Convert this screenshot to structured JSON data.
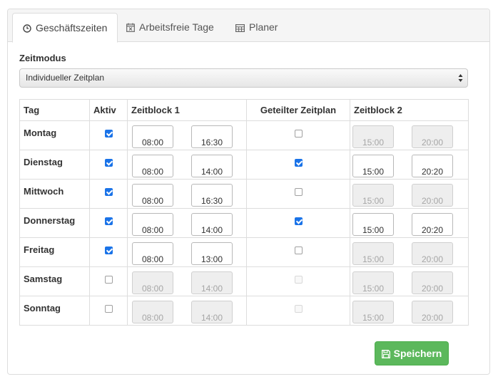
{
  "tabs": [
    {
      "label": "Geschäftszeiten",
      "icon": "clock-icon",
      "active": true
    },
    {
      "label": "Arbeitsfreie Tage",
      "icon": "calendar-x-icon",
      "active": false
    },
    {
      "label": "Planer",
      "icon": "table-icon",
      "active": false
    }
  ],
  "zeitmodus": {
    "label": "Zeitmodus",
    "selected": "Individueller Zeitplan"
  },
  "table": {
    "headers": {
      "tag": "Tag",
      "aktiv": "Aktiv",
      "block1": "Zeitblock 1",
      "geteilt": "Geteilter Zeitplan",
      "block2": "Zeitblock 2"
    },
    "rows": [
      {
        "day": "Montag",
        "active": true,
        "b1_start": "08:00",
        "b1_end": "16:30",
        "split": false,
        "b2_start": "15:00",
        "b2_end": "20:00"
      },
      {
        "day": "Dienstag",
        "active": true,
        "b1_start": "08:00",
        "b1_end": "14:00",
        "split": true,
        "b2_start": "15:00",
        "b2_end": "20:20"
      },
      {
        "day": "Mittwoch",
        "active": true,
        "b1_start": "08:00",
        "b1_end": "16:30",
        "split": false,
        "b2_start": "15:00",
        "b2_end": "20:00"
      },
      {
        "day": "Donnerstag",
        "active": true,
        "b1_start": "08:00",
        "b1_end": "14:00",
        "split": true,
        "b2_start": "15:00",
        "b2_end": "20:20"
      },
      {
        "day": "Freitag",
        "active": true,
        "b1_start": "08:00",
        "b1_end": "13:00",
        "split": false,
        "b2_start": "15:00",
        "b2_end": "20:00"
      },
      {
        "day": "Samstag",
        "active": false,
        "b1_start": "08:00",
        "b1_end": "14:00",
        "split": false,
        "b2_start": "15:00",
        "b2_end": "20:00"
      },
      {
        "day": "Sonntag",
        "active": false,
        "b1_start": "08:00",
        "b1_end": "14:00",
        "split": false,
        "b2_start": "15:00",
        "b2_end": "20:00"
      }
    ]
  },
  "save_button": {
    "label": "Speichern",
    "icon": "floppy-disk-icon"
  },
  "colors": {
    "accent": "#1a73e8",
    "save": "#5cb85c"
  }
}
